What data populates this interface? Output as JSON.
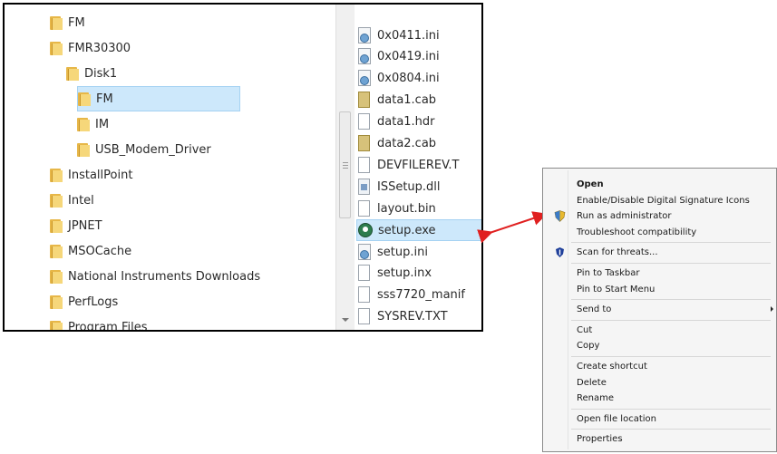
{
  "explorer": {
    "tree_items": [
      {
        "label": "FM",
        "indent": 1,
        "selected": false
      },
      {
        "label": "FMR30300",
        "indent": 1,
        "selected": false
      },
      {
        "label": "Disk1",
        "indent": 2,
        "selected": false
      },
      {
        "label": "FM",
        "indent": 3,
        "selected": true
      },
      {
        "label": "IM",
        "indent": 3,
        "selected": false
      },
      {
        "label": "USB_Modem_Driver",
        "indent": 3,
        "selected": false
      },
      {
        "label": "InstallPoint",
        "indent": 0,
        "selected": false
      },
      {
        "label": "Intel",
        "indent": 0,
        "selected": false
      },
      {
        "label": "JPNET",
        "indent": 0,
        "selected": false
      },
      {
        "label": "MSOCache",
        "indent": 0,
        "selected": false
      },
      {
        "label": "National Instruments Downloads",
        "indent": 0,
        "selected": false
      },
      {
        "label": "PerfLogs",
        "indent": 0,
        "selected": false
      },
      {
        "label": "Program Files",
        "indent": 0,
        "selected": false
      }
    ],
    "files": [
      {
        "name": "0x0411.ini",
        "icon": "ini-settings-icon",
        "selected": false
      },
      {
        "name": "0x0419.ini",
        "icon": "ini-settings-icon",
        "selected": false
      },
      {
        "name": "0x0804.ini",
        "icon": "ini-settings-icon",
        "selected": false
      },
      {
        "name": "data1.cab",
        "icon": "cabinet-archive-icon",
        "selected": false
      },
      {
        "name": "data1.hdr",
        "icon": "blank-document-icon",
        "selected": false
      },
      {
        "name": "data2.cab",
        "icon": "cabinet-archive-icon",
        "selected": false
      },
      {
        "name": "DEVFILEREV.T",
        "icon": "text-document-icon",
        "selected": false
      },
      {
        "name": "ISSetup.dll",
        "icon": "dll-library-icon",
        "selected": false
      },
      {
        "name": "layout.bin",
        "icon": "blank-document-icon",
        "selected": false
      },
      {
        "name": "setup.exe",
        "icon": "installer-exe-icon",
        "selected": true
      },
      {
        "name": "setup.ini",
        "icon": "ini-settings-icon",
        "selected": false
      },
      {
        "name": "setup.inx",
        "icon": "blank-document-icon",
        "selected": false
      },
      {
        "name": "sss7720_manif",
        "icon": "text-document-icon",
        "selected": false
      },
      {
        "name": "SYSREV.TXT",
        "icon": "text-document-icon",
        "selected": false
      }
    ]
  },
  "context_menu": {
    "items": [
      {
        "label": "Open",
        "bold": true,
        "icon": null
      },
      {
        "label": "Enable/Disable Digital Signature Icons",
        "bold": false,
        "icon": null
      },
      {
        "label": "Run as administrator",
        "bold": false,
        "icon": "uac-shield-icon"
      },
      {
        "label": "Troubleshoot compatibility",
        "bold": false,
        "icon": null
      },
      {
        "sep": true
      },
      {
        "label": "Scan for threats...",
        "bold": false,
        "icon": "antivirus-shield-icon"
      },
      {
        "sep": true
      },
      {
        "label": "Pin to Taskbar",
        "bold": false,
        "icon": null
      },
      {
        "label": "Pin to Start Menu",
        "bold": false,
        "icon": null
      },
      {
        "sep": true
      },
      {
        "label": "Send to",
        "bold": false,
        "icon": null,
        "submenu": true
      },
      {
        "sep": true
      },
      {
        "label": "Cut",
        "bold": false,
        "icon": null
      },
      {
        "label": "Copy",
        "bold": false,
        "icon": null
      },
      {
        "sep": true
      },
      {
        "label": "Create shortcut",
        "bold": false,
        "icon": null
      },
      {
        "label": "Delete",
        "bold": false,
        "icon": null
      },
      {
        "label": "Rename",
        "bold": false,
        "icon": null
      },
      {
        "sep": true
      },
      {
        "label": "Open file location",
        "bold": false,
        "icon": null
      },
      {
        "sep": true
      },
      {
        "label": "Properties",
        "bold": false,
        "icon": null
      }
    ]
  },
  "colors": {
    "selection_bg": "#cde8fb",
    "arrow": "#e02020",
    "folder": "#e7b748"
  }
}
